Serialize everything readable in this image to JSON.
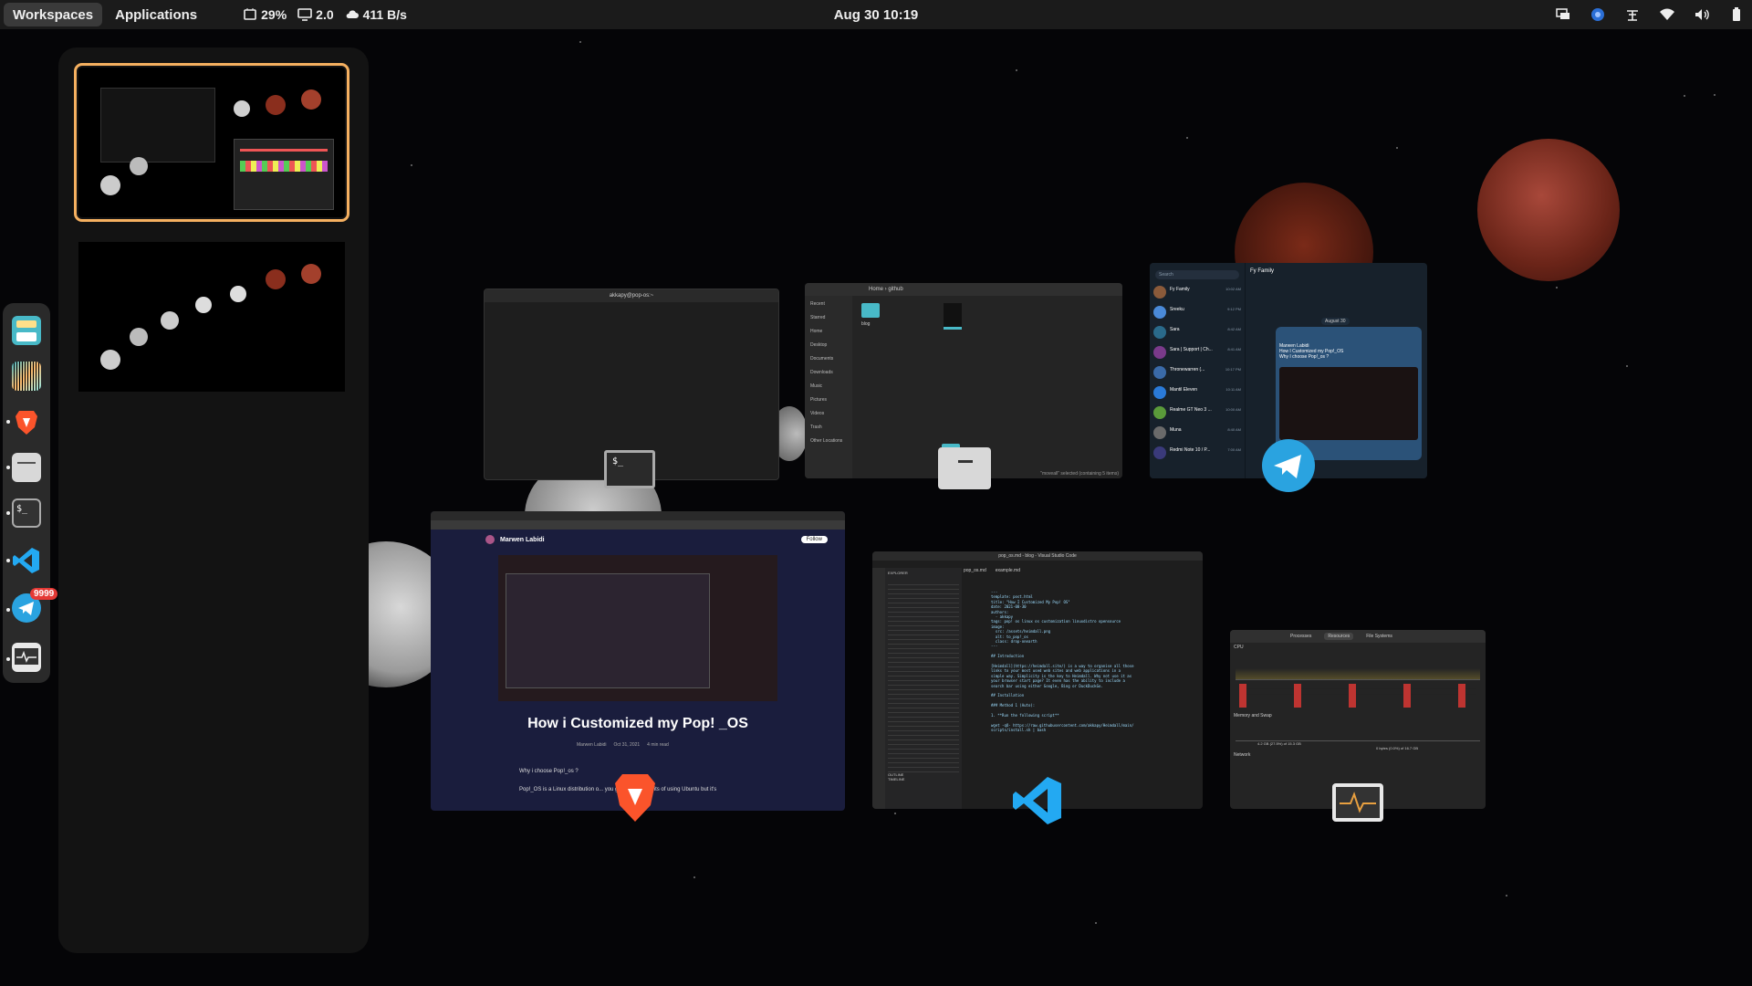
{
  "topbar": {
    "workspaces_label": "Workspaces",
    "applications_label": "Applications",
    "cpu_usage": "29%",
    "load_average": "2.0",
    "network_speed": "411 B/s",
    "clock": "Aug 30  10:19"
  },
  "colors": {
    "accent": "#f5b060",
    "panel_bg": "#1b1b1b",
    "badge": "#e53935",
    "brave": "#fb542b",
    "vscode": "#23a9f2",
    "telegram": "#2aa3e0"
  },
  "dock": {
    "items": [
      {
        "name": "pop-shop-icon",
        "running": false
      },
      {
        "name": "app-grid-icon",
        "running": false
      },
      {
        "name": "brave-icon",
        "running": true
      },
      {
        "name": "files-icon",
        "running": true
      },
      {
        "name": "terminal-icon",
        "running": true
      },
      {
        "name": "vscode-icon",
        "running": true
      },
      {
        "name": "telegram-icon",
        "running": true,
        "badge": "9999"
      },
      {
        "name": "system-monitor-icon",
        "running": true
      }
    ]
  },
  "windows": {
    "terminal": {
      "title": "akkapy@pop-os:~",
      "prompt": "$_"
    },
    "files": {
      "path_home": "Home",
      "path_folder": "github",
      "sidebar": [
        "Recent",
        "Starred",
        "Home",
        "Desktop",
        "Documents",
        "Downloads",
        "Music",
        "Pictures",
        "Videos",
        "Trash",
        "Other Locations"
      ],
      "folder_name": "blog",
      "status": "\"moveall\" selected (containing 5 items)"
    },
    "telegram": {
      "search_placeholder": "Search",
      "chat_title": "Fy Family",
      "chats": [
        {
          "name": "Fy Family",
          "time": "10:02 AM"
        },
        {
          "name": "Sreeku",
          "time": "9:12 PM"
        },
        {
          "name": "Sara",
          "time": "8:42 AM"
        },
        {
          "name": "Sara | Support | Ch...",
          "time": "8:41 AM"
        },
        {
          "name": "Thronewarren (...",
          "time": "10:17 PM"
        },
        {
          "name": "Mantil Eleven",
          "time": "10:11 AM"
        },
        {
          "name": "Realme GT Neo 3 ...",
          "time": "10:00 AM"
        },
        {
          "name": "Muna",
          "time": "8:40 AM"
        },
        {
          "name": "Redmi Note 10 / P...",
          "time": "7:00 AM"
        }
      ],
      "date_divider": "August 30",
      "message_title": "How I Customized my Pop!_OS",
      "message_author": "Marwen Labidi",
      "message_sub": "Why I choose Pop!_os ?"
    },
    "brave": {
      "author": "Marwen Labidi",
      "follow_label": "Follow",
      "article_title": "How i Customized my Pop! _OS",
      "article_date": "Oct 31, 2021",
      "read_time": "4 min read",
      "intro_q": "Why i choose Pop!_os ?",
      "intro_text": "Pop!_OS is a Linux distribution o... you get all the benefits of using Ubuntu but it's"
    },
    "vscode": {
      "title": "pop_os.md - blog - Visual Studio Code",
      "tab1": "pop_os.md",
      "tab2": "example.md",
      "explorer_label": "EXPLORER",
      "outline_label": "OUTLINE",
      "timeline_label": "TIMELINE",
      "code_lines": [
        "---",
        "template: post.html",
        "title: \"How I Customized My Pop! OS\"",
        "date: 2021-08-30",
        "authors:",
        "  - akkapy",
        "tags: pop! os linux os customization linuxdistro opensource",
        "image:",
        "  src: /assets/heimdall.png",
        "  alt: to_pop!_os",
        "  class: drop-onearth",
        "---",
        "",
        "## Introduction",
        "",
        "[Heimdall](https://heimdall.site/) is a way to organise all those",
        "links to your most used web sites and web applications in a",
        "simple way. Simplicity is the key to Heimdall. Why not use it as",
        "your browser start page? It even has the ability to include a",
        "search bar using either Google, Bing or DuckDuckGo.",
        "",
        "## Installation",
        "",
        "### Method 1 (Auto):",
        "",
        "1. **Run the following script**",
        "",
        "wget -qO- https://raw.githubusercontent.com/akkapy/Heimdall/main/",
        "scripts/install.sh | bash"
      ]
    },
    "monitor": {
      "tab_processes": "Processes",
      "tab_resources": "Resources",
      "tab_filesystems": "File Systems",
      "cpu_label": "CPU",
      "memory_label": "Memory and Swap",
      "network_label": "Network",
      "memory_value": "4.2 GB (27.5%) of 15.3 GB",
      "swap_value": "0 bytes (0.0%) of 16.7 GB"
    }
  }
}
